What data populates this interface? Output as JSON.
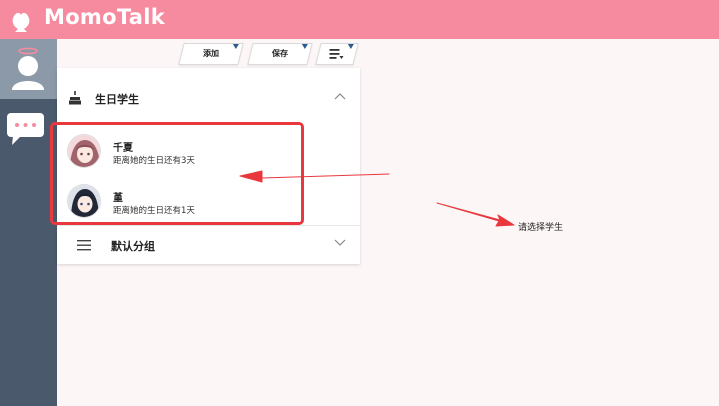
{
  "app": {
    "title": "MomoTalk"
  },
  "toolbar": {
    "add_label": "添加",
    "save_label": "保存",
    "menu_icon": "list-menu-icon"
  },
  "groups": [
    {
      "label": "生日学生",
      "icon": "birthday-cake-icon",
      "expanded": true,
      "students": [
        {
          "name": "千夏",
          "subtitle": "距离她的生日还有3天"
        },
        {
          "name": "堇",
          "subtitle": "距离她的生日还有1天"
        }
      ]
    },
    {
      "label": "默认分组",
      "icon": "hamburger-icon",
      "expanded": false
    }
  ],
  "hint": "请选择学生",
  "colors": {
    "topbar": "#f68a9e",
    "rail": "#4b596d",
    "rail_active": "#8c99a8",
    "annotation": "#e8383d",
    "background": "#fdf6f7"
  }
}
